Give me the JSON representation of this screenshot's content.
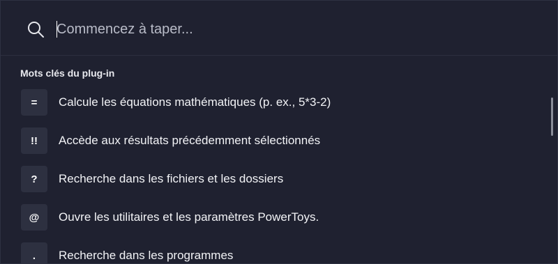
{
  "search": {
    "placeholder": "Commencez à taper...",
    "value": ""
  },
  "section": {
    "title": "Mots clés du plug-in"
  },
  "results": [
    {
      "key": "=",
      "description": "Calcule les équations mathématiques (p. ex., 5*3-2)"
    },
    {
      "key": "!!",
      "description": "Accède aux résultats précédemment sélectionnés"
    },
    {
      "key": "?",
      "description": "Recherche dans les fichiers et les dossiers"
    },
    {
      "key": "@",
      "description": "Ouvre les utilitaires et les paramètres PowerToys."
    },
    {
      "key": ".",
      "description": "Recherche dans les programmes"
    }
  ],
  "colors": {
    "background": "#1f2130",
    "badge": "#2d3040",
    "scrollbar": "#8a8d99"
  },
  "icons": {
    "search": "search-icon"
  }
}
